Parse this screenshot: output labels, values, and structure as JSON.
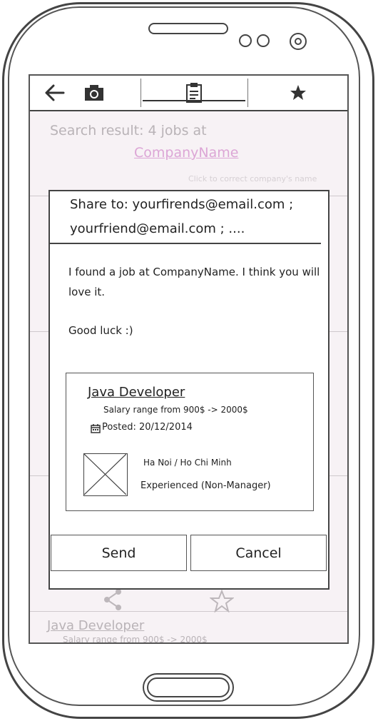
{
  "toolbar": {
    "back_icon": "arrow-left-icon",
    "camera_icon": "camera-icon",
    "clipboard_icon": "clipboard-icon",
    "star_icon": "star-icon"
  },
  "background": {
    "search_result_text": "Search result: 4 jobs at",
    "company_link": "CompanyName",
    "correct_hint": "Click to correct company's name",
    "bottom_job_title": "Java Developer",
    "bottom_salary": "Salary range from 900$ -> 2000$"
  },
  "dialog": {
    "share_to_line1": "Share to: yourfirends@email.com ;",
    "share_to_line2": "yourfriend@email.com ; ....",
    "message_line1": "I found a job at CompanyName. I think you will",
    "message_line2": "love it.",
    "message_line3": "Good luck :)",
    "card": {
      "title": "Java Developer",
      "salary": "Salary range from 900$ -> 2000$",
      "posted": "Posted: 20/12/2014",
      "location": "Ha Noi / Ho Chi Minh",
      "level": "Experienced (Non-Manager)"
    },
    "send_label": "Send",
    "cancel_label": "Cancel"
  }
}
